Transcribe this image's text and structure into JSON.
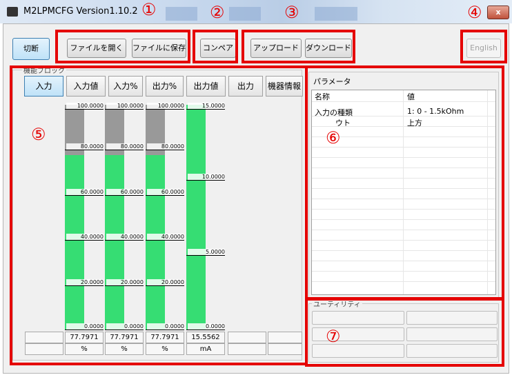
{
  "window": {
    "title": "M2LPMCFG Version1.10.2",
    "close_label": "x"
  },
  "toolbar": {
    "disconnect": "切断",
    "open_file": "ファイルを開く",
    "save_file": "ファイルに保存",
    "compare": "コンペア",
    "upload": "アップロード",
    "download": "ダウンロード",
    "english": "English"
  },
  "function_block": {
    "group_label": "機能ブロック",
    "tabs": [
      "入力",
      "入力値",
      "入力%",
      "出力%",
      "出力値",
      "出力",
      "機器情報"
    ],
    "active_tab": "入力"
  },
  "chart_data": {
    "type": "bar",
    "series": [
      {
        "scale": [
          "100.0000",
          "80.0000",
          "60.0000",
          "40.0000",
          "20.0000",
          "0.0000"
        ],
        "range": [
          0,
          100
        ],
        "value": 77.7971,
        "value_text": "77.7971",
        "unit": "%"
      },
      {
        "scale": [
          "100.0000",
          "80.0000",
          "60.0000",
          "40.0000",
          "20.0000",
          "0.0000"
        ],
        "range": [
          0,
          100
        ],
        "value": 77.7971,
        "value_text": "77.7971",
        "unit": "%"
      },
      {
        "scale": [
          "100.0000",
          "80.0000",
          "60.0000",
          "40.0000",
          "20.0000",
          "0.0000"
        ],
        "range": [
          0,
          100
        ],
        "value": 77.7971,
        "value_text": "77.7971",
        "unit": "%"
      },
      {
        "scale": [
          "15.0000",
          "10.0000",
          "5.0000",
          "0.0000"
        ],
        "range": [
          0,
          15
        ],
        "value": 15.5562,
        "value_text": "15.5562",
        "unit": "mA"
      }
    ],
    "colors": {
      "fill": "#36dd73",
      "empty": "#999999"
    }
  },
  "parameters": {
    "group_label": "パラメータ",
    "headers": [
      "名称",
      "値"
    ],
    "rows": [
      {
        "name": "入力の種類",
        "value": "1: 0 - 1.5kOhm"
      },
      {
        "name": "ウト",
        "value": "上方"
      }
    ]
  },
  "utility": {
    "group_label": "ユーティリティ"
  },
  "annotations": [
    "①",
    "②",
    "③",
    "④",
    "⑤",
    "⑥",
    "⑦"
  ],
  "colors": {
    "highlight": "#e50000",
    "accent_tab": "#bfe2f8"
  }
}
